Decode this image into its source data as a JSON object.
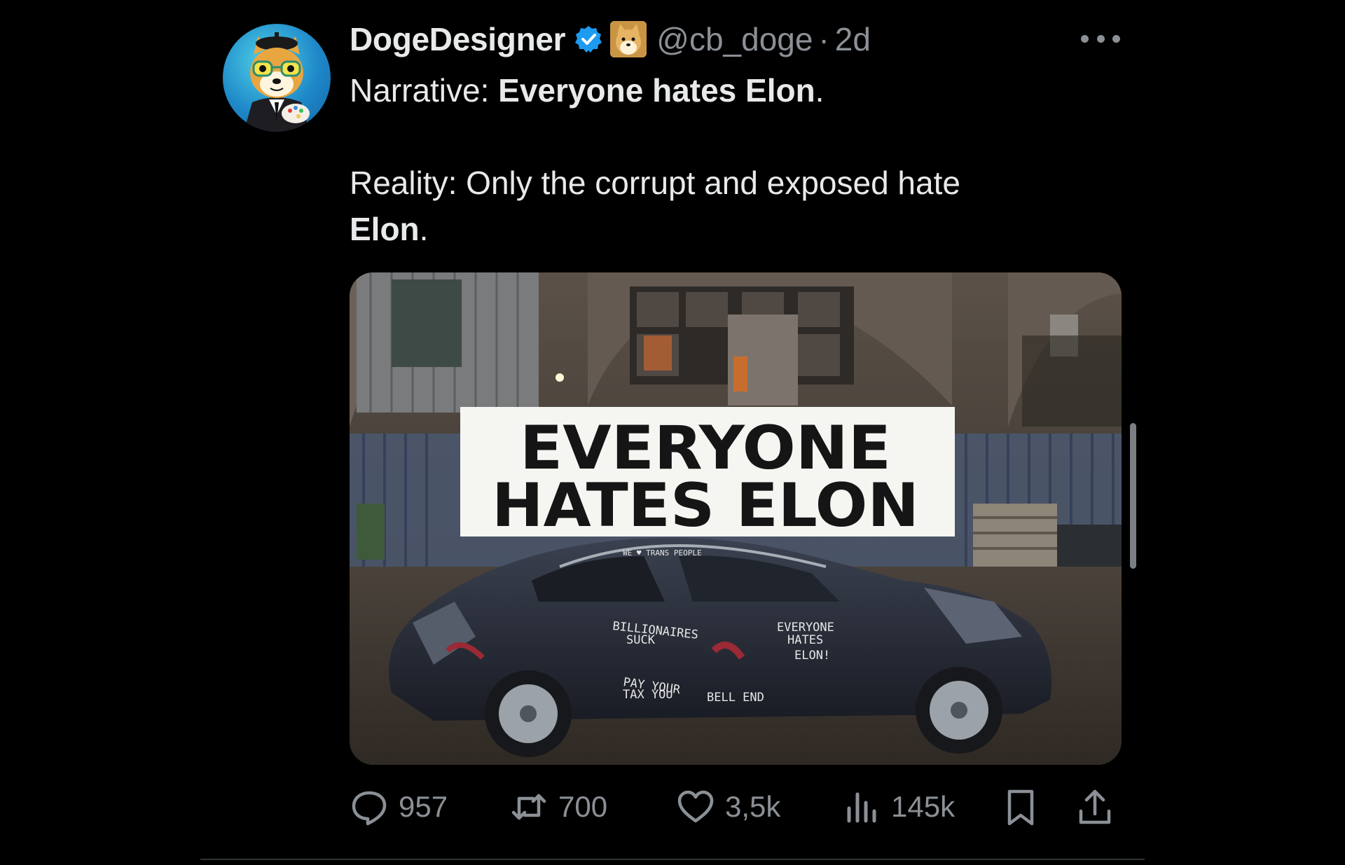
{
  "tweet": {
    "display_name": "DogeDesigner",
    "handle": "@cb_doge",
    "separator": "·",
    "time": "2d",
    "text_line1_prefix": "Narrative: ",
    "text_line1_bold": "Everyone hates Elon",
    "text_line1_suffix": ".",
    "text_line2": "Reality: Only the corrupt and exposed hate",
    "text_line3_bold": "Elon",
    "text_line3_suffix": "."
  },
  "media": {
    "banner_line1": "EVERYONE",
    "banner_line2": "HATES ELON",
    "graffiti_billionaires": "BILLIONAIRES",
    "graffiti_suck": "SUCK",
    "graffiti_pay": "PAY YOUR",
    "graffiti_tax": "TAX YOU",
    "graffiti_bellend": "BELL END",
    "graffiti_everyone": "EVERYONE",
    "graffiti_hates": "HATES",
    "graffiti_elon": "ELON!",
    "graffiti_roof": "WE ♥ TRANS PEOPLE"
  },
  "actions": {
    "replies": "957",
    "reposts": "700",
    "likes": "3,5k",
    "views": "145k"
  },
  "icons": {
    "more": "more-dots-icon",
    "verified": "verified-badge-icon",
    "affiliate": "doge-affiliate-badge-icon",
    "reply": "reply-icon",
    "repost": "repost-icon",
    "like": "heart-icon",
    "views": "views-icon",
    "bookmark": "bookmark-icon",
    "share": "share-icon"
  },
  "colors": {
    "background": "#000000",
    "text_primary": "#e7e9ea",
    "text_secondary": "#8b9096",
    "verified_blue": "#1d9bf0"
  }
}
